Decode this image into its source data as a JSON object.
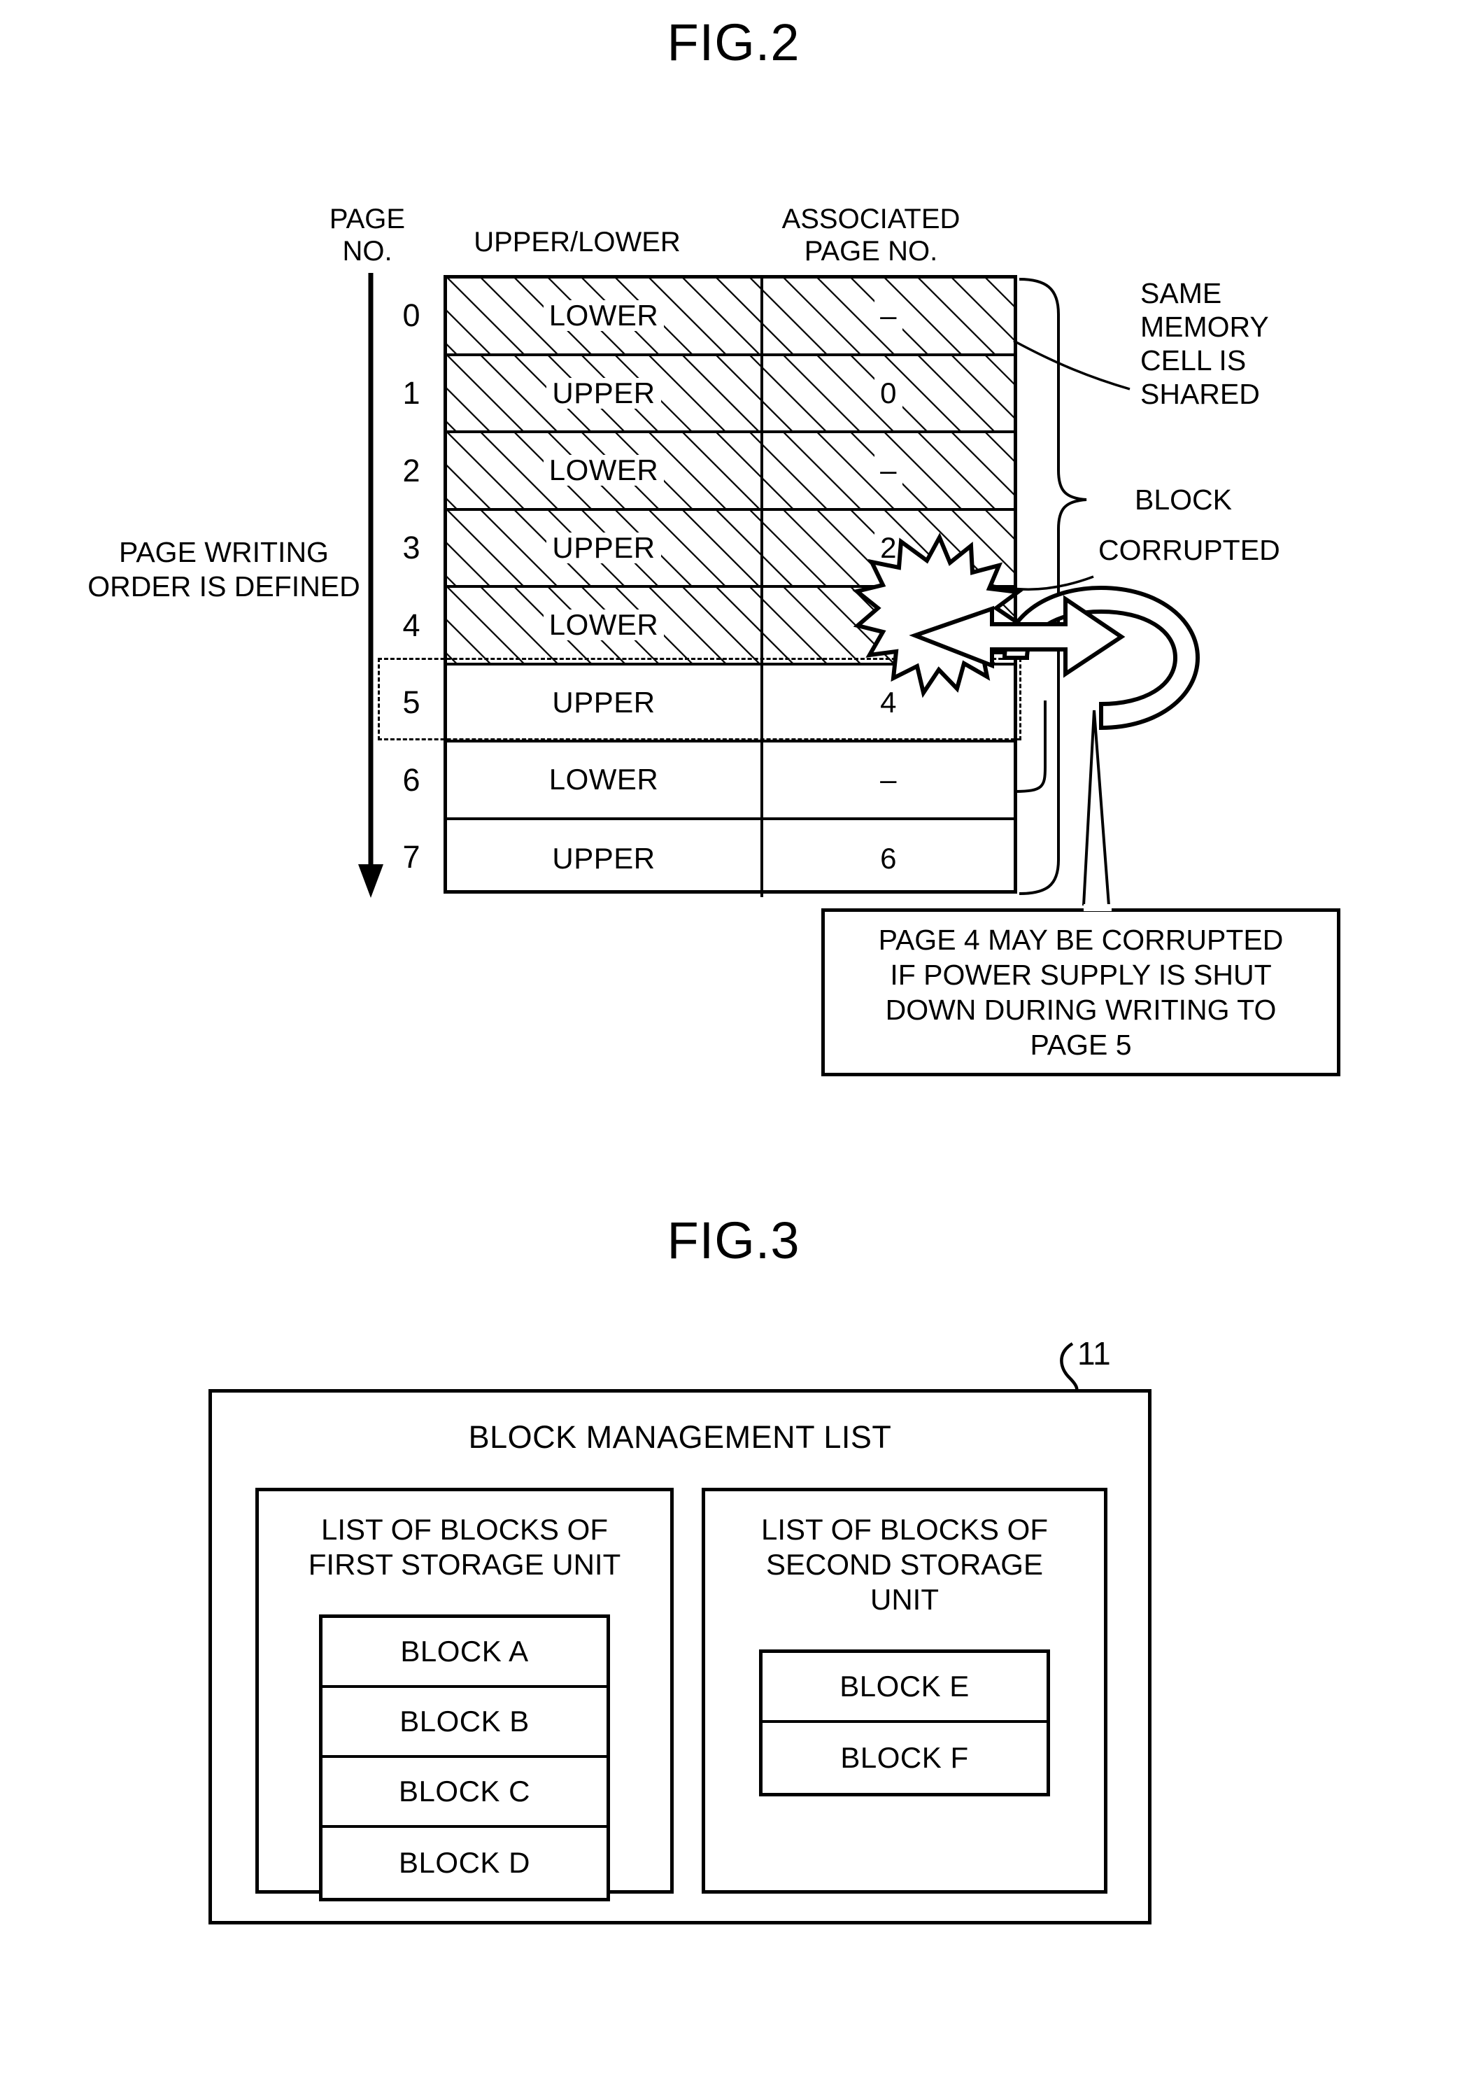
{
  "figures": {
    "fig2": {
      "title": "FIG.2",
      "headers": {
        "page_no": "PAGE\nNO.",
        "upper_lower": "UPPER/LOWER",
        "associated_page_no": "ASSOCIATED\nPAGE NO."
      },
      "side_label": "PAGE WRITING\nORDER IS DEFINED",
      "table": {
        "columns": [
          "PAGE NO.",
          "UPPER/LOWER",
          "ASSOCIATED PAGE NO."
        ],
        "rows": [
          {
            "page_no": "0",
            "upper_lower": "LOWER",
            "associated": "–",
            "hatched": true
          },
          {
            "page_no": "1",
            "upper_lower": "UPPER",
            "associated": "0",
            "hatched": true
          },
          {
            "page_no": "2",
            "upper_lower": "LOWER",
            "associated": "–",
            "hatched": true
          },
          {
            "page_no": "3",
            "upper_lower": "UPPER",
            "associated": "2",
            "hatched": true
          },
          {
            "page_no": "4",
            "upper_lower": "LOWER",
            "associated": "–",
            "hatched": true
          },
          {
            "page_no": "5",
            "upper_lower": "UPPER",
            "associated": "4",
            "hatched": false
          },
          {
            "page_no": "6",
            "upper_lower": "LOWER",
            "associated": "–",
            "hatched": false
          },
          {
            "page_no": "7",
            "upper_lower": "UPPER",
            "associated": "6",
            "hatched": false
          }
        ]
      },
      "annotations": {
        "same_memory_cell": "SAME\nMEMORY\nCELL IS\nSHARED",
        "block": "BLOCK",
        "corrupted": "CORRUPTED"
      },
      "callout": "PAGE 4 MAY BE CORRUPTED\nIF POWER SUPPLY IS SHUT\nDOWN DURING WRITING TO\nPAGE 5"
    },
    "fig3": {
      "title": "FIG.3",
      "reference_numeral": "11",
      "block_management_list_title": "BLOCK MANAGEMENT LIST",
      "storage_units": [
        {
          "title": "LIST OF BLOCKS OF\nFIRST STORAGE UNIT",
          "blocks": [
            "BLOCK A",
            "BLOCK B",
            "BLOCK C",
            "BLOCK D"
          ]
        },
        {
          "title": "LIST OF BLOCKS OF\nSECOND STORAGE\nUNIT",
          "blocks": [
            "BLOCK E",
            "BLOCK F"
          ]
        }
      ]
    }
  },
  "colors": {
    "ink": "#000000",
    "paper": "#ffffff"
  }
}
